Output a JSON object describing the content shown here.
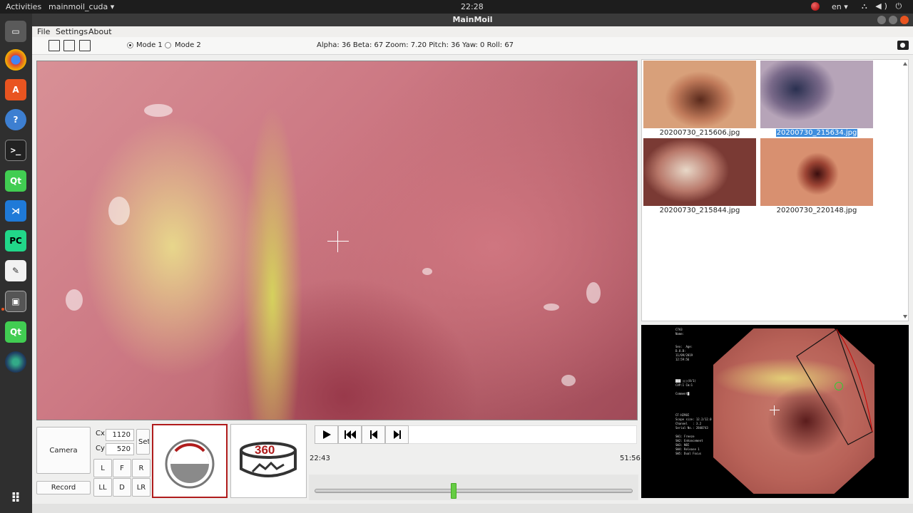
{
  "topbar": {
    "activities": "Activities",
    "app_menu": "mainmoil_cuda ▾",
    "clock": "22:28",
    "lang": "en ▾",
    "sys_icons": "⛬ ◀) ⏻ ▾"
  },
  "window": {
    "title": "MainMoil"
  },
  "menu": {
    "file": "File",
    "settings": "Settings",
    "about": "About"
  },
  "toolbar": {
    "mode1": "Mode 1",
    "mode2": "Mode 2",
    "selected_mode": "Mode 1",
    "status": "Alpha: 36   Beta: 67   Zoom: 7.20   Pitch: 36   Yaw: 0   Roll: 67"
  },
  "thumbnails": [
    {
      "name": "20200730_215606.jpg",
      "selected": false
    },
    {
      "name": "20200730_215634.jpg",
      "selected": true
    },
    {
      "name": "20200730_215844.jpg",
      "selected": false
    },
    {
      "name": "20200730_220148.jpg",
      "selected": false
    }
  ],
  "overview": {
    "info_top": "C7A3\nName:\n\n\nSex:  Age:\nD.O.B:\n11/09/2019\n12:59:56",
    "info_mid": "███ ▯▯▯(8/1)\nCVP:1 Cm:1\n\nComment█",
    "info_bottom": "CF-H290I\nScope size: 12.2/12.0\nChannel   : 3.2\nSerial No.: 2840743\n\nSW1: Freeze\nSW2: Enhancement\nSW3: NBI\nSW4: Release 1\nSW5: Dual Focus"
  },
  "controls": {
    "camera_label": "Camera",
    "record_label": "Record",
    "cx_label": "Cx",
    "cx_value": "1120",
    "cy_label": "Cy",
    "cy_value": "520",
    "set_label": "Set",
    "dir_buttons": [
      "L",
      "F",
      "R",
      "LL",
      "D",
      "LR"
    ],
    "view360_label": "360"
  },
  "player": {
    "time_current": "22:43",
    "time_total": "51:56",
    "progress_fraction": 0.437
  },
  "colors": {
    "accent": "#e95420",
    "selection": "#3e8ede",
    "slider_handle": "#66cc44",
    "view_border": "#b01c1c"
  }
}
